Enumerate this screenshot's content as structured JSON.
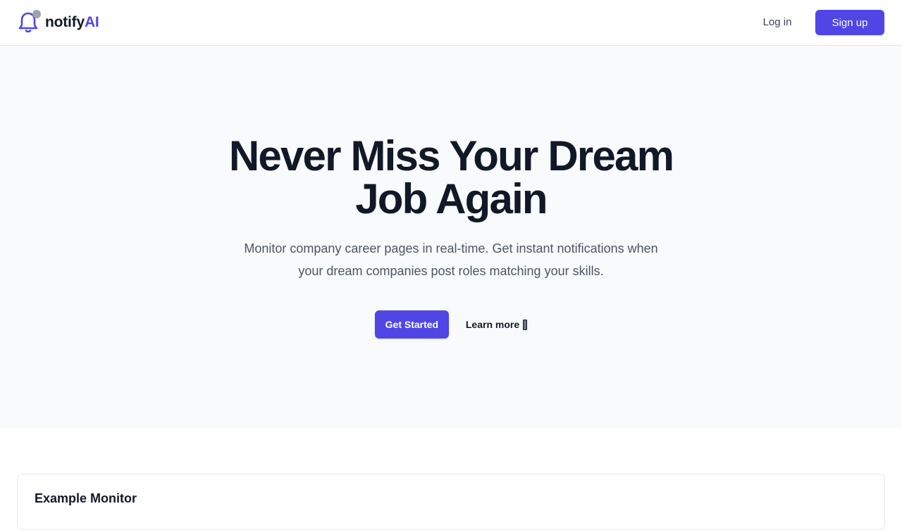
{
  "header": {
    "brand_prefix": "notify",
    "brand_accent": "AI",
    "brand_icon": "bell-icon",
    "login_label": "Log in",
    "signup_label": "Sign up"
  },
  "hero": {
    "title_line1": "Never Miss Your Dream",
    "title_line2": "Job Again",
    "subtitle_line1": "Monitor company career pages in real-time. Get instant notifications when",
    "subtitle_line2": "your dream companies post roles matching your skills.",
    "primary_cta": "Get Started",
    "secondary_cta": "Learn more"
  },
  "monitor": {
    "title": "Example Monitor"
  },
  "colors": {
    "accent": "#4f46e5",
    "hero_bg": "#f9fafb",
    "text": "#111827",
    "muted_text": "#4b5563"
  }
}
